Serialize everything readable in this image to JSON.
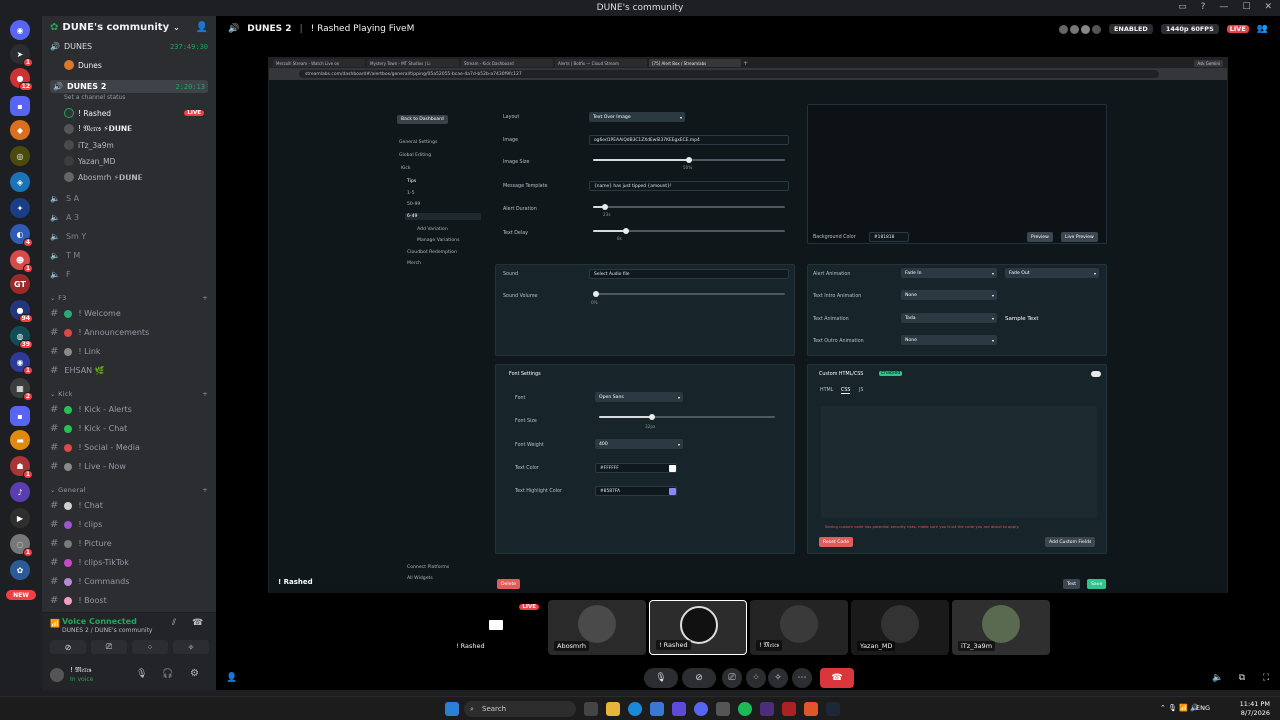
{
  "window": {
    "title": "DUNE's community"
  },
  "server": {
    "name": "DUNE's community"
  },
  "voice_channels": [
    {
      "name": "DUNES",
      "time": "237:49:30"
    },
    {
      "name": "DUNES 2",
      "time": "2:20:13",
      "status": "Set a channel status"
    }
  ],
  "dunes_member": "Dunes",
  "dunes2_members": [
    {
      "name": "! Rashed",
      "live": "LIVE"
    },
    {
      "name": "! 𝔐𝔢𝔯𝔠𝔰 ⚡𝗗𝗨𝗡𝗘"
    },
    {
      "name": "iTz_3a9m"
    },
    {
      "name": "Yazan_MD"
    },
    {
      "name": "Abosmrh ⚡𝗗𝗨𝗡𝗘"
    }
  ],
  "speaker_channels": [
    "S A",
    "A 3",
    "Sm Y",
    "T M",
    "F"
  ],
  "categories": {
    "f3": {
      "label": "F3",
      "channels": [
        "! Welcome",
        "! Announcements",
        "! Link",
        "EHSAN 🌿"
      ]
    },
    "kick": {
      "label": "Kick",
      "channels": [
        "! Kick - Alerts",
        "! Kick - Chat",
        "! Social - Media",
        "! Live - Now"
      ]
    },
    "general": {
      "label": "General",
      "channels": [
        "! Chat",
        "! clips",
        "! Picture",
        "! clips-TikTok",
        "! Commands",
        "! Boost"
      ]
    }
  },
  "voice_panel": {
    "status": "Voice Connected",
    "location": "DUNES 2 / DUNE's community"
  },
  "user_panel": {
    "name": "! 𝔐𝔢𝔯𝔠𝔰",
    "status": "In voice"
  },
  "main_header": {
    "channel": "DUNES 2",
    "stream_title": "! Rashed Playing FiveM",
    "enabled_label": "ENABLED",
    "quality_label": "1440p 60FPS",
    "live_label": "LIVE"
  },
  "browser": {
    "tabs": [
      "Merzolll Stream - Watch Live on",
      "Mystery Town - MT Studios | Li",
      "Stream - Kick Dashboard",
      "Alerts | Botfix — Cloud Stream",
      "[75] Alert Box / Streamlabs"
    ],
    "url": "streamlabs.com/dashboard#/alertbox/general/tipping/05a52055-bcae-4a7d-b52b-a7430f9fc127",
    "ask_label": "Ask Gemini"
  },
  "streamlabs": {
    "back": "Back to Dashboard",
    "nav": [
      "General Settings",
      "Global Editing",
      "Kick",
      "Tips",
      "1-5",
      "50-99",
      "6-49",
      "Add Variation",
      "Manage Variations",
      "Cloudbot Redemption",
      "Merch"
    ],
    "connect": "Connect Platforms",
    "widgets": "All Widgets",
    "layout_label": "Layout",
    "layout_value": "Text Over Image",
    "image_label": "Image",
    "image_value": "og6ed1PEAAiQdB3C1ZXdEwSI37KEEgxECE.mp4",
    "image_size_label": "Image Size",
    "image_size_value": "50%",
    "image_size_pct": 0.5,
    "message_label": "Message Template",
    "message_value": "{name} has just tipped {amount}!",
    "alert_duration_label": "Alert Duration",
    "alert_duration_value": "23s",
    "alert_duration_pct": 0.06,
    "text_delay_label": "Text Delay",
    "text_delay_value": "8s",
    "text_delay_pct": 0.17,
    "bg_color_label": "Background Color",
    "bg_color_value": "#181818",
    "preview": "Preview",
    "live_preview": "Live Preview",
    "sound_label": "Sound",
    "sound_value": "Select Audio file",
    "sound_volume_label": "Sound Volume",
    "sound_volume_value": "0%",
    "alert_anim_label": "Alert Animation",
    "alert_anim_in": "Fade In",
    "alert_anim_out": "Fade Out",
    "text_intro_label": "Text Intro Animation",
    "text_intro_value": "None",
    "text_anim_label": "Text Animation",
    "text_anim_value": "Tada",
    "sample_text": "Sample Text",
    "text_outro_label": "Text Outro Animation",
    "text_outro_value": "None",
    "font_settings": "Font Settings",
    "font_label": "Font",
    "font_value": "Open Sans",
    "font_size_label": "Font Size",
    "font_size_value": "32px",
    "font_size_pct": 0.3,
    "font_weight_label": "Font Weight",
    "font_weight_value": "400",
    "text_color_label": "Text Color",
    "text_color_value": "#FFFFFF",
    "highlight_label": "Text Highlight Color",
    "highlight_value": "#8587FA",
    "custom_html": "Custom HTML/CSS",
    "enabled": "Enabled",
    "tabs": [
      "HTML",
      "CSS",
      "JS"
    ],
    "warning": "Saving custom code has potential security risks, make sure you trust the code you are about to apply.",
    "reset": "Reset Code",
    "add_fields": "Add Custom Fields",
    "delete": "Delete",
    "test": "Test",
    "save": "Save"
  },
  "stream_footer_name": "! Rashed",
  "participants": [
    {
      "name": "! Rashed",
      "live": "LIVE"
    },
    {
      "name": "Abosmrh"
    },
    {
      "name": "! Rashed"
    },
    {
      "name": "! 𝔐𝔢𝔯𝔠𝔰"
    },
    {
      "name": "Yazan_MD"
    },
    {
      "name": "iTz_3a9m"
    }
  ],
  "taskbar": {
    "search": "Search",
    "lang": "ENG",
    "time": "11:41 PM",
    "date": "8/7/2026"
  },
  "colors": {
    "accent_live": "#ed4245",
    "voice_green": "#23a55a",
    "save_green": "#31c48d",
    "delete_red": "#e25c5c",
    "blurple": "#5865f2"
  }
}
